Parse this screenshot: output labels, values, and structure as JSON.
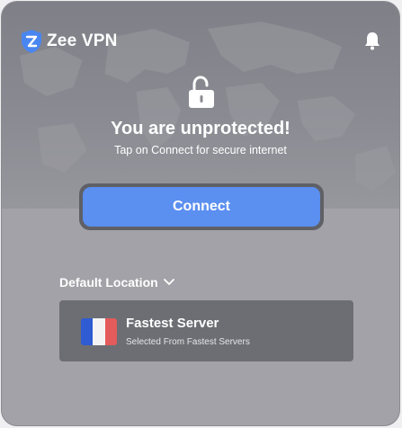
{
  "app": {
    "brand_name": "Zee VPN"
  },
  "icons": {
    "logo": "shield-logo-icon",
    "notifications": "bell-icon",
    "lock": "unlocked-padlock-icon",
    "dropdown": "chevron-down-icon"
  },
  "status": {
    "title": "You are unprotected!",
    "subtitle": "Tap on Connect for secure internet"
  },
  "connect_button": {
    "label": "Connect"
  },
  "location": {
    "label": "Default Location",
    "server": {
      "name": "Fastest Server",
      "subtitle": "Selected From Fastest Servers",
      "flag_colors": [
        "#2f5bd3",
        "#f4f4f4",
        "#e35b5b"
      ]
    }
  },
  "colors": {
    "accent": "#5b8ff0",
    "panel": "#a2a2a8",
    "card": "#6d6e74",
    "header": "#83848b"
  }
}
